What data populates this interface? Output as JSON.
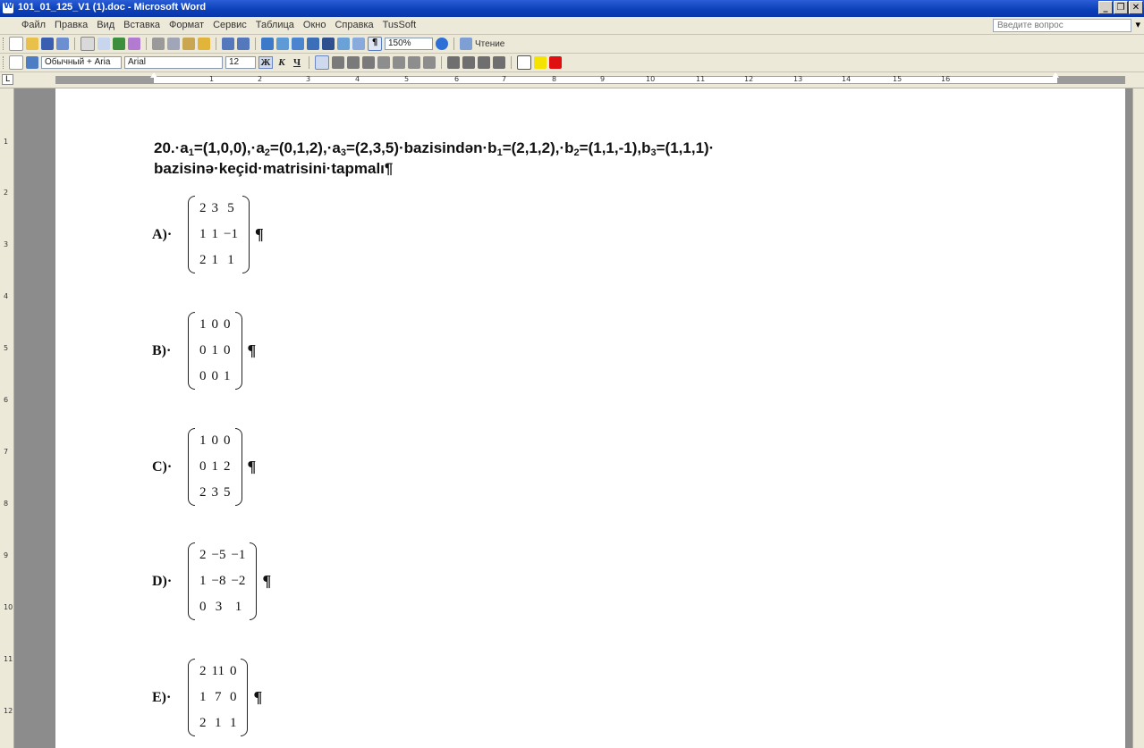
{
  "window": {
    "title": "101_01_125_V1 (1).doc - Microsoft Word",
    "controls": [
      "_",
      "❐",
      "✕"
    ]
  },
  "menu": {
    "items": [
      "Файл",
      "Правка",
      "Вид",
      "Вставка",
      "Формат",
      "Сервис",
      "Таблица",
      "Окно",
      "Справка",
      "TusSoft"
    ],
    "help_placeholder": "Введите вопрос"
  },
  "toolbar": {
    "zoom": "150%",
    "reading_label": "Чтение",
    "style": "Обычный + Aria",
    "font": "Arial",
    "size": "12"
  },
  "ruler": {
    "numbers": [
      "1",
      "2",
      "3",
      "4",
      "5",
      "6",
      "7",
      "8",
      "9",
      "10",
      "11",
      "12",
      "13",
      "14",
      "15",
      "16"
    ]
  },
  "document": {
    "question": {
      "line1_parts": [
        "20.·a",
        "1",
        "=(1,0,0),·a",
        "2",
        "=(0,1,2),·a",
        "3",
        "=(2,3,5)·bazisindən·b",
        "1",
        "=(2,1,2),·b",
        "2",
        "=(1,1,-1),b",
        "3",
        "=(1,1,1)·"
      ],
      "line2": "bazisinə·keçid·matrisini·tapmalı¶"
    },
    "options": [
      {
        "label": "A)·",
        "rows": [
          [
            "2",
            "3",
            "5"
          ],
          [
            "1",
            "1",
            "−1"
          ],
          [
            "2",
            "1",
            "1"
          ]
        ]
      },
      {
        "label": "B)·",
        "rows": [
          [
            "1",
            "0",
            "0"
          ],
          [
            "0",
            "1",
            "0"
          ],
          [
            "0",
            "0",
            "1"
          ]
        ]
      },
      {
        "label": "C)·",
        "rows": [
          [
            "1",
            "0",
            "0"
          ],
          [
            "0",
            "1",
            "2"
          ],
          [
            "2",
            "3",
            "5"
          ]
        ]
      },
      {
        "label": "D)·",
        "rows": [
          [
            "2",
            "−5",
            "−1"
          ],
          [
            "1",
            "−8",
            "−2"
          ],
          [
            "0",
            "3",
            "1"
          ]
        ]
      },
      {
        "label": "E)·",
        "rows": [
          [
            "2",
            "11",
            "0"
          ],
          [
            "1",
            "7",
            "0"
          ],
          [
            "2",
            "1",
            "1"
          ]
        ]
      }
    ],
    "pilcrow": "¶"
  },
  "colors": {
    "titlebar": "#0a3fb8",
    "chrome": "#ece9d8",
    "workspace": "#8c8c8c"
  }
}
